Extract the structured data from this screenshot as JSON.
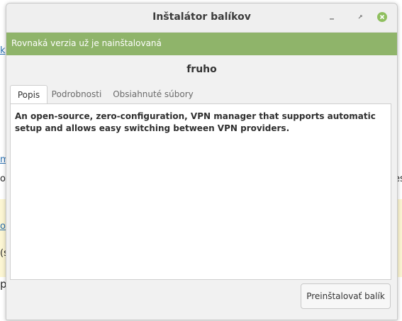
{
  "window": {
    "title": "Inštalátor balíkov",
    "controls": [
      "minimize-icon",
      "maximize-icon",
      "close-icon"
    ],
    "close_color": "#8fbf5f"
  },
  "infobar": {
    "message": "Rovnaká verzia už je nainštalovaná",
    "color": "#8fb46a"
  },
  "package": {
    "name": "fruho"
  },
  "tabs": [
    {
      "label": "Popis",
      "active": true
    },
    {
      "label": "Podrobnosti",
      "active": false
    },
    {
      "label": "Obsiahnuté súbory",
      "active": false
    }
  ],
  "description": "An open-source, zero-configuration, VPN manager that supports automatic setup and allows easy switching between VPN providers.",
  "action": {
    "label": "Preinštalovať balík"
  },
  "background_fragments": {
    "a": "k",
    "b": "m",
    "c": "ot",
    "d": "es",
    "e": "o",
    "f": "(s",
    "g": "p"
  }
}
